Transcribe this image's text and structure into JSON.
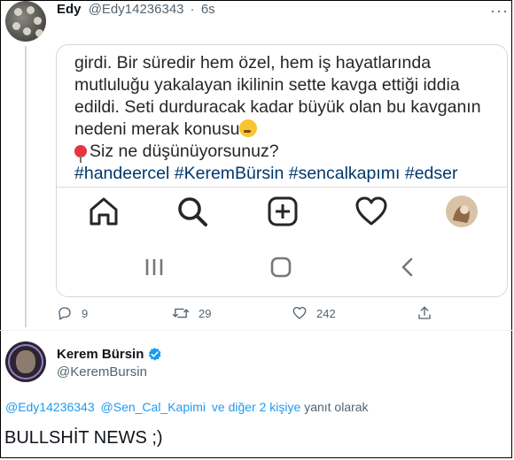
{
  "tweet": {
    "author_name": "Edy",
    "author_handle": "@Edy14236343",
    "separator": "·",
    "time": "6s",
    "more_icon": "more-horizontal-icon",
    "embedded_screenshot": {
      "caption_lines": [
        "girdi. Bir süredir hem özel, hem iş hayatlarında",
        "mutluluğu yakalayan ikilinin sette kavga ettiği iddia",
        "edildi. Seti durduracak kadar büyük olan bu kavganın",
        "nedeni merak konusu"
      ],
      "question": "Siz ne düşünüyorsunuz?",
      "hashtags": "#handeercel #KeremBürsin #sencalkapımı #edser",
      "nav_icons": [
        "home-icon",
        "search-icon",
        "new-post-icon",
        "heart-icon",
        "profile-avatar"
      ],
      "system_icons": [
        "recent-apps-icon",
        "home-button-icon",
        "back-icon"
      ]
    },
    "actions": {
      "replies": "9",
      "retweets": "29",
      "likes": "242"
    },
    "colors": {
      "link": "#1d9bf0",
      "instagram_link": "#00376b",
      "muted": "#536471"
    }
  },
  "reply": {
    "author_name": "Kerem Bürsin",
    "verified_icon": "verified-badge-icon",
    "author_handle": "@KeremBursin",
    "replying_to_mention_1": "@Edy14236343",
    "replying_to_mention_2": "@Sen_Cal_Kapimi",
    "replying_to_rest": "ve diğer 2 kişiye",
    "replying_to_suffix": "yanıt olarak",
    "body": "BULLSHİT NEWS ;)"
  }
}
